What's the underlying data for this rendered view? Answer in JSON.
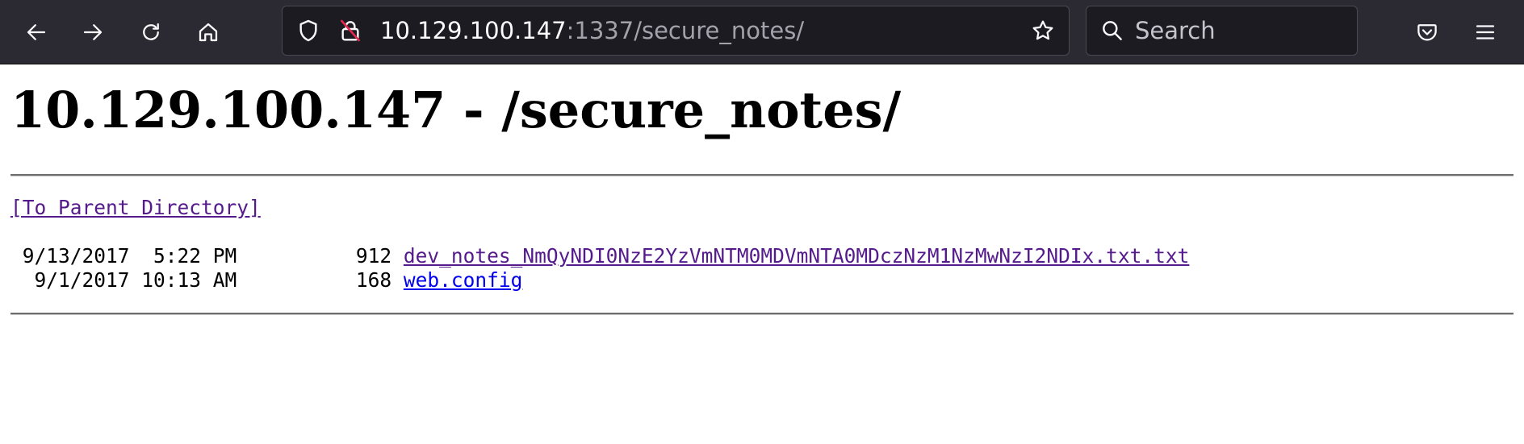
{
  "browser": {
    "url": {
      "host": "10.129.100.147",
      "rest": ":1337/secure_notes/"
    },
    "search": {
      "placeholder": "Search"
    },
    "icons": {
      "back": "back-arrow-icon",
      "forward": "forward-arrow-icon",
      "reload": "reload-icon",
      "home": "home-icon",
      "shield": "tracking-protection-shield-icon",
      "lock": "insecure-lock-icon",
      "bookmark": "bookmark-star-icon",
      "search": "search-icon",
      "pocket": "pocket-icon",
      "menu": "hamburger-menu-icon"
    },
    "colors": {
      "toolbar": "#2b2a33",
      "field": "#1c1b22"
    }
  },
  "page": {
    "title": "10.129.100.147 - /secure_notes/",
    "parent_link": "[To Parent Directory]",
    "files": [
      {
        "date": "9/13/2017",
        "time": "5:22 PM",
        "size": "912",
        "name": "dev_notes_NmQyNDI0NzE2YzVmNTM0MDVmNTA0MDczNzM1NzMwNzI2NDIx.txt.txt"
      },
      {
        "date": "9/1/2017",
        "time": "10:13 AM",
        "size": "168",
        "name": "web.config"
      }
    ],
    "colors": {
      "link": "#0000ee",
      "visited_link": "#551a8b"
    }
  }
}
